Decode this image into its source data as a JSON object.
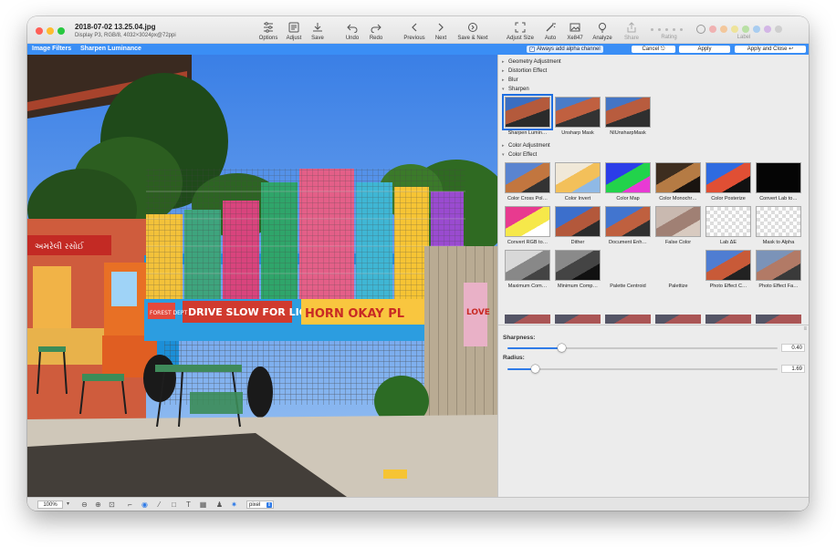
{
  "window": {
    "title": "2018-07-02 13.25.04.jpg",
    "subtitle": "Display P3, RGB/8, 4032×3024px@72ppi"
  },
  "toolbar": {
    "options": "Options",
    "adjust": "Adjust",
    "save": "Save",
    "undo": "Undo",
    "redo": "Redo",
    "previous": "Previous",
    "next": "Next",
    "save_next": "Save & Next",
    "adjust_size": "Adjust Size",
    "auto": "Auto",
    "xe847": "Xe847",
    "analyze": "Analyze",
    "share": "Share",
    "rating": "Rating",
    "label": "Label",
    "label_colors": [
      "#f0b2b2",
      "#f3c79c",
      "#eee39a",
      "#b9e0a5",
      "#a9cdf0",
      "#d3b6e6",
      "#cfcfcf"
    ]
  },
  "filterbar": {
    "title": "Image Filters",
    "filter_name": "Sharpen Luminance",
    "alpha_label": "Always add alpha channel",
    "cancel": "Cancel ⎋",
    "apply": "Apply",
    "apply_close": "Apply and Close ↩",
    "accent": "#3a8ef5"
  },
  "browser": {
    "categories_top": [
      "Geometry Adjustment",
      "Distortion Effect",
      "Blur",
      "Sharpen"
    ],
    "sharpen_items": [
      "Sharpen Lumin…",
      "Unsharp Mask",
      "NIUnsharpMask"
    ],
    "categories_mid": [
      "Color Adjustment",
      "Color Effect"
    ],
    "color_effect_items": [
      [
        "Color Cross Pol…",
        "Color Invert",
        "Color Map",
        "Color Monochr…",
        "Color Posterize",
        "Convert Lab to…"
      ],
      [
        "Convert RGB to…",
        "Dither",
        "Document Enh…",
        "False Color",
        "Lab ΔE",
        "Mask to Alpha"
      ],
      [
        "Maximum Com…",
        "Minimum Comp…",
        "Palette Centroid",
        "Palettize",
        "Photo Effect C…",
        "Photo Effect Fa…"
      ]
    ]
  },
  "params": {
    "sharpness_label": "Sharpness:",
    "sharpness_value": "0.40",
    "sharpness_fraction": 0.2,
    "radius_label": "Radius:",
    "radius_value": "1.69",
    "radius_fraction": 0.1
  },
  "photo": {
    "sign_truck_1": "DRIVE SLOW FOR LIONS",
    "sign_truck_2": "HORN OKAY PL",
    "sign_side": "FOREST DEPT",
    "sign_shop": "અમરેલી રસોઈ",
    "poster": "LOVE"
  },
  "statusbar": {
    "zoom": "100%",
    "unit": "pixel"
  }
}
